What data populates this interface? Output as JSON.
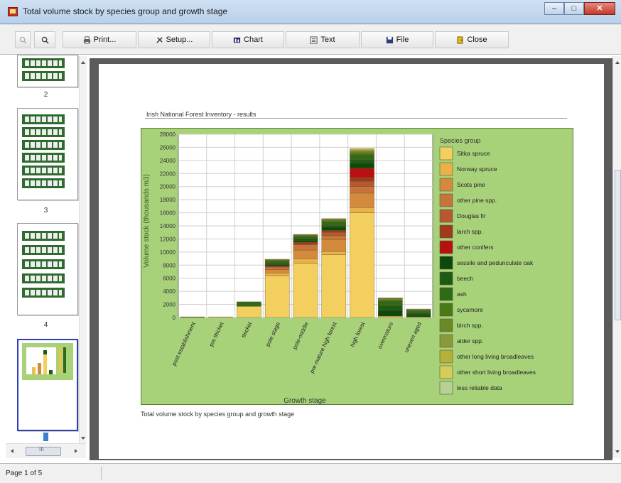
{
  "window": {
    "title": "Total volume stock by species group and growth stage",
    "min": "–",
    "max": "□",
    "close": "✕"
  },
  "toolbar": {
    "print": "Print...",
    "setup": "Setup...",
    "chart": "Chart",
    "text": "Text",
    "file": "File",
    "close": "Close"
  },
  "thumbnails": {
    "labels": [
      "2",
      "3",
      "4"
    ],
    "scroll_mark": "III"
  },
  "report": {
    "heading": "Irish National Forest Inventory - results",
    "caption": "Total volume stock by species group and growth stage"
  },
  "status": {
    "page": "Page 1 of 5"
  },
  "chart_data": {
    "type": "bar",
    "stacked": true,
    "ylabel": "Volume stock (thousands m3)",
    "xlabel": "Growth stage",
    "ylim": [
      0,
      28000
    ],
    "yticks": [
      0,
      2000,
      4000,
      6000,
      8000,
      10000,
      12000,
      14000,
      16000,
      18000,
      20000,
      22000,
      24000,
      26000,
      28000
    ],
    "grid": true,
    "legend_title": "Species group",
    "legend_position": "right",
    "categories": [
      "post establishment",
      "pre thicket",
      "thicket",
      "pole stage",
      "pole-middle",
      "pre mature high forest",
      "high forest",
      "overmature",
      "uneven aged"
    ],
    "series": [
      {
        "name": "Sitka spruce",
        "color": "#f2cf5e",
        "values": [
          0,
          100,
          1700,
          6400,
          8300,
          9600,
          16000,
          200,
          100
        ]
      },
      {
        "name": "Norway spruce",
        "color": "#eab04a",
        "values": [
          0,
          0,
          0,
          400,
          700,
          500,
          800,
          0,
          0
        ]
      },
      {
        "name": "Scots pine",
        "color": "#d48a3c",
        "values": [
          0,
          0,
          0,
          500,
          1300,
          1800,
          2200,
          0,
          0
        ]
      },
      {
        "name": "other pine spp.",
        "color": "#c6743a",
        "values": [
          0,
          0,
          0,
          400,
          800,
          600,
          1000,
          0,
          0
        ]
      },
      {
        "name": "Douglas fir",
        "color": "#b45a2e",
        "values": [
          0,
          0,
          0,
          0,
          100,
          500,
          800,
          0,
          0
        ]
      },
      {
        "name": "larch spp.",
        "color": "#9e3a1e",
        "values": [
          0,
          0,
          0,
          200,
          300,
          300,
          600,
          0,
          0
        ]
      },
      {
        "name": "other conifers",
        "color": "#b81010",
        "values": [
          0,
          0,
          0,
          0,
          0,
          0,
          1400,
          0,
          0
        ]
      },
      {
        "name": "sessile and pedunculate oak",
        "color": "#0c4a0c",
        "values": [
          0,
          0,
          0,
          200,
          300,
          500,
          800,
          900,
          300
        ]
      },
      {
        "name": "beech",
        "color": "#1e5a14",
        "values": [
          0,
          0,
          0,
          200,
          300,
          300,
          500,
          700,
          300
        ]
      },
      {
        "name": "ash",
        "color": "#2e6a18",
        "values": [
          100,
          0,
          700,
          300,
          300,
          500,
          800,
          700,
          300
        ]
      },
      {
        "name": "sycamore",
        "color": "#4a7a18",
        "values": [
          0,
          0,
          0,
          100,
          100,
          200,
          200,
          200,
          100
        ]
      },
      {
        "name": "birch spp.",
        "color": "#6a8a28",
        "values": [
          0,
          0,
          0,
          100,
          100,
          200,
          200,
          200,
          100
        ]
      },
      {
        "name": "alder spp.",
        "color": "#8a9a38",
        "values": [
          0,
          0,
          0,
          100,
          100,
          100,
          200,
          100,
          100
        ]
      },
      {
        "name": "other long living broadleaves",
        "color": "#b4b03a",
        "values": [
          0,
          0,
          0,
          0,
          0,
          0,
          300,
          0,
          0
        ]
      },
      {
        "name": "other short living broadleaves",
        "color": "#d6cc5a",
        "values": [
          0,
          0,
          0,
          0,
          0,
          0,
          0,
          0,
          0
        ]
      },
      {
        "name": "less reliable data",
        "color": "#b6d096",
        "values": [
          0,
          0,
          0,
          0,
          0,
          0,
          0,
          0,
          0
        ]
      }
    ]
  }
}
